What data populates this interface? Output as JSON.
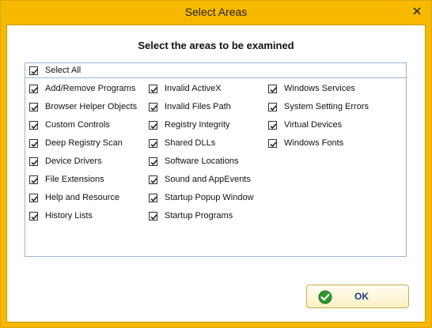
{
  "window": {
    "title": "Select Areas"
  },
  "heading": "Select the areas to be examined",
  "select_all": {
    "label": "Select All",
    "checked": true
  },
  "areas": {
    "column1": [
      {
        "label": "Add/Remove Programs",
        "checked": true
      },
      {
        "label": "Browser Helper Objects",
        "checked": true
      },
      {
        "label": "Custom Controls",
        "checked": true
      },
      {
        "label": "Deep Registry Scan",
        "checked": true
      },
      {
        "label": "Device Drivers",
        "checked": true
      },
      {
        "label": "File Extensions",
        "checked": true
      },
      {
        "label": "Help and Resource",
        "checked": true
      },
      {
        "label": "History Lists",
        "checked": true
      }
    ],
    "column2": [
      {
        "label": "Invalid ActiveX",
        "checked": true
      },
      {
        "label": "Invalid Files Path",
        "checked": true
      },
      {
        "label": "Registry Integrity",
        "checked": true
      },
      {
        "label": "Shared DLLs",
        "checked": true
      },
      {
        "label": "Software Locations",
        "checked": true
      },
      {
        "label": "Sound and AppEvents",
        "checked": true
      },
      {
        "label": "Startup Popup Window",
        "checked": true
      },
      {
        "label": "Startup Programs",
        "checked": true
      }
    ],
    "column3": [
      {
        "label": "Windows Services",
        "checked": true
      },
      {
        "label": "System Setting Errors",
        "checked": true
      },
      {
        "label": "Virtual Devices",
        "checked": true
      },
      {
        "label": "Windows Fonts",
        "checked": true
      }
    ]
  },
  "ok_button": {
    "label": "OK",
    "icon": "checkmark-circle-icon"
  },
  "colors": {
    "titlebar": "#f8b800",
    "panel_border": "#9ab4d6",
    "ok_icon": "#2f9a2f"
  }
}
